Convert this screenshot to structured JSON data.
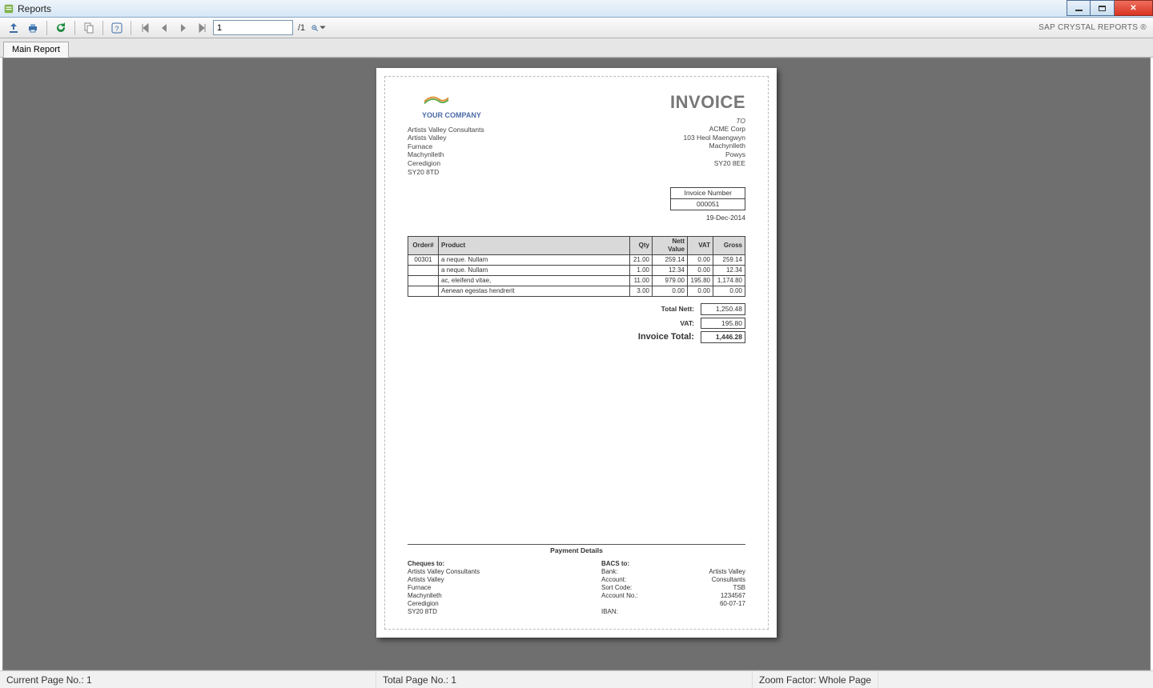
{
  "window": {
    "title": "Reports"
  },
  "toolbar": {
    "page_input": "1",
    "page_total": "/1",
    "brand": "SAP CRYSTAL REPORTS ®"
  },
  "tabs": {
    "main": "Main Report"
  },
  "statusbar": {
    "current": "Current Page No.: 1",
    "total": "Total Page No.: 1",
    "zoom": "Zoom Factor: Whole Page"
  },
  "invoice": {
    "title": "INVOICE",
    "company_name": "YOUR COMPANY",
    "from_addr": [
      "Artists Valley Consultants",
      "Artists Valley",
      "Furnace",
      "Machynlleth",
      "Ceredigion",
      "SY20 8TD"
    ],
    "to_label": "TO",
    "to_addr": [
      "ACME Corp",
      "103 Heol Maengwyn",
      "Machynlleth",
      "Powys",
      "SY20 8EE"
    ],
    "num_label": "Invoice Number",
    "num_value": "000051",
    "date": "19-Dec-2014",
    "cols": {
      "order": "Order#",
      "product": "Product",
      "qty": "Qty",
      "nett": "Nett Value",
      "vat": "VAT",
      "gross": "Gross"
    },
    "lines": [
      {
        "order": "00301",
        "product": "a neque. Nullam",
        "qty": "21.00",
        "nett": "259.14",
        "vat": "0.00",
        "gross": "259.14"
      },
      {
        "order": "",
        "product": "a neque. Nullam",
        "qty": "1.00",
        "nett": "12.34",
        "vat": "0.00",
        "gross": "12.34"
      },
      {
        "order": "",
        "product": "ac, eleifend vitae,",
        "qty": "11.00",
        "nett": "979.00",
        "vat": "195.80",
        "gross": "1,174.80"
      },
      {
        "order": "",
        "product": "Aenean egestas hendrerit",
        "qty": "3.00",
        "nett": "0.00",
        "vat": "0.00",
        "gross": "0.00"
      }
    ],
    "totals": {
      "nett_label": "Total Nett:",
      "nett": "1,250.48",
      "vat_label": "VAT:",
      "vat": "195.80",
      "total_label": "Invoice Total:",
      "total": "1,446.28"
    },
    "payment": {
      "heading": "Payment Details",
      "cheques_label": "Cheques to:",
      "cheques_addr": [
        "Artists Valley Consultants",
        "Artists Valley",
        "Furnace",
        "Machynlleth",
        "Ceredigion",
        "SY20 8TD"
      ],
      "bacs_label": "BACS to:",
      "bacs": {
        "bank_k": "Bank:",
        "bank_v": "Artists Valley",
        "acct_k": "Account:",
        "acct_v": "Consultants",
        "sort_k": "Sort Code:",
        "sort_v": "TSB",
        "acctno_k": "Account No.:",
        "acctno_v": "1234567",
        "extra_v": "60-07-17",
        "iban_k": "IBAN:"
      }
    }
  }
}
